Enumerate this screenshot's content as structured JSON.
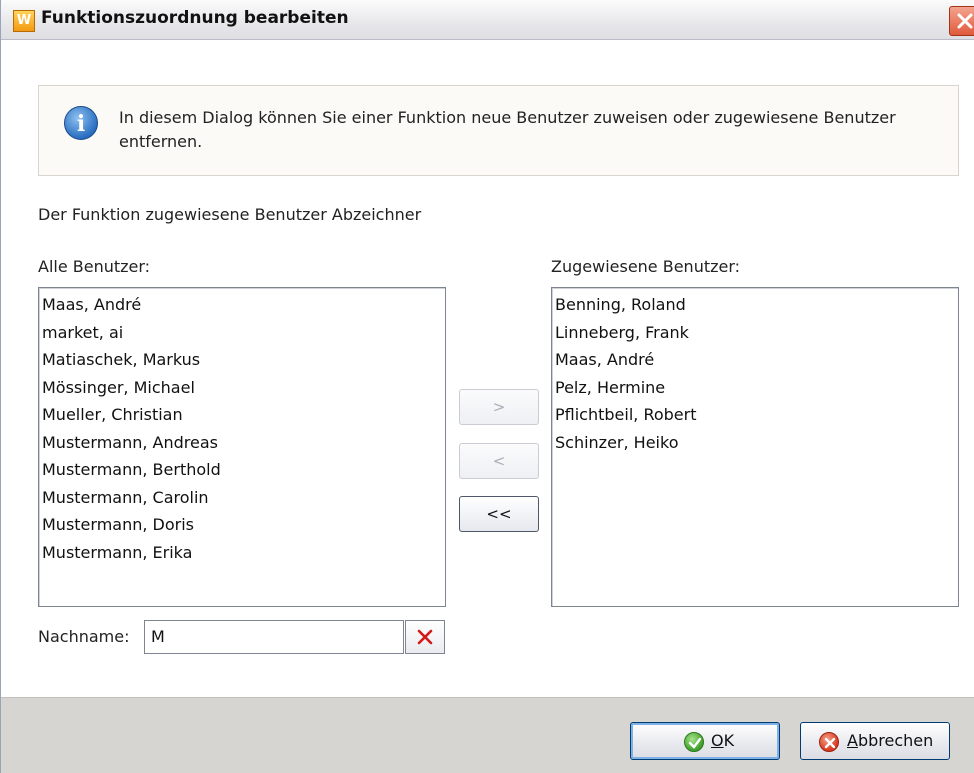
{
  "window": {
    "title": "Funktionszuordnung bearbeiten",
    "app_icon_glyph": "W"
  },
  "info": {
    "icon": "info-icon",
    "text": "In diesem Dialog können Sie einer Funktion neue Benutzer zuweisen oder zugewiesene Benutzer entfernen."
  },
  "subtitle": "Der Funktion zugewiesene Benutzer Abzeichner",
  "all_users": {
    "label": "Alle Benutzer:",
    "items": [
      "Maas, André",
      "market, ai",
      "Matiaschek, Markus",
      "Mössinger, Michael",
      "Mueller, Christian",
      "Mustermann, Andreas",
      "Mustermann, Berthold",
      "Mustermann, Carolin",
      "Mustermann, Doris",
      "Mustermann, Erika"
    ]
  },
  "assigned_users": {
    "label": "Zugewiesene Benutzer:",
    "items": [
      "Benning, Roland",
      "Linneberg, Frank",
      "Maas, André",
      "Pelz, Hermine",
      "Pflichtbeil, Robert",
      "Schinzer, Heiko"
    ]
  },
  "move_buttons": {
    "add": ">",
    "remove": "<",
    "remove_all": "<<"
  },
  "filter": {
    "label": "Nachname:",
    "value": "M"
  },
  "footer": {
    "ok_mnemonic": "O",
    "ok_rest": "K",
    "cancel_mnemonic": "A",
    "cancel_rest": "bbrechen"
  },
  "colors": {
    "accent_border": "#003c74",
    "footer_bg": "#d6d5d1",
    "close_red": "#e05a3a"
  }
}
